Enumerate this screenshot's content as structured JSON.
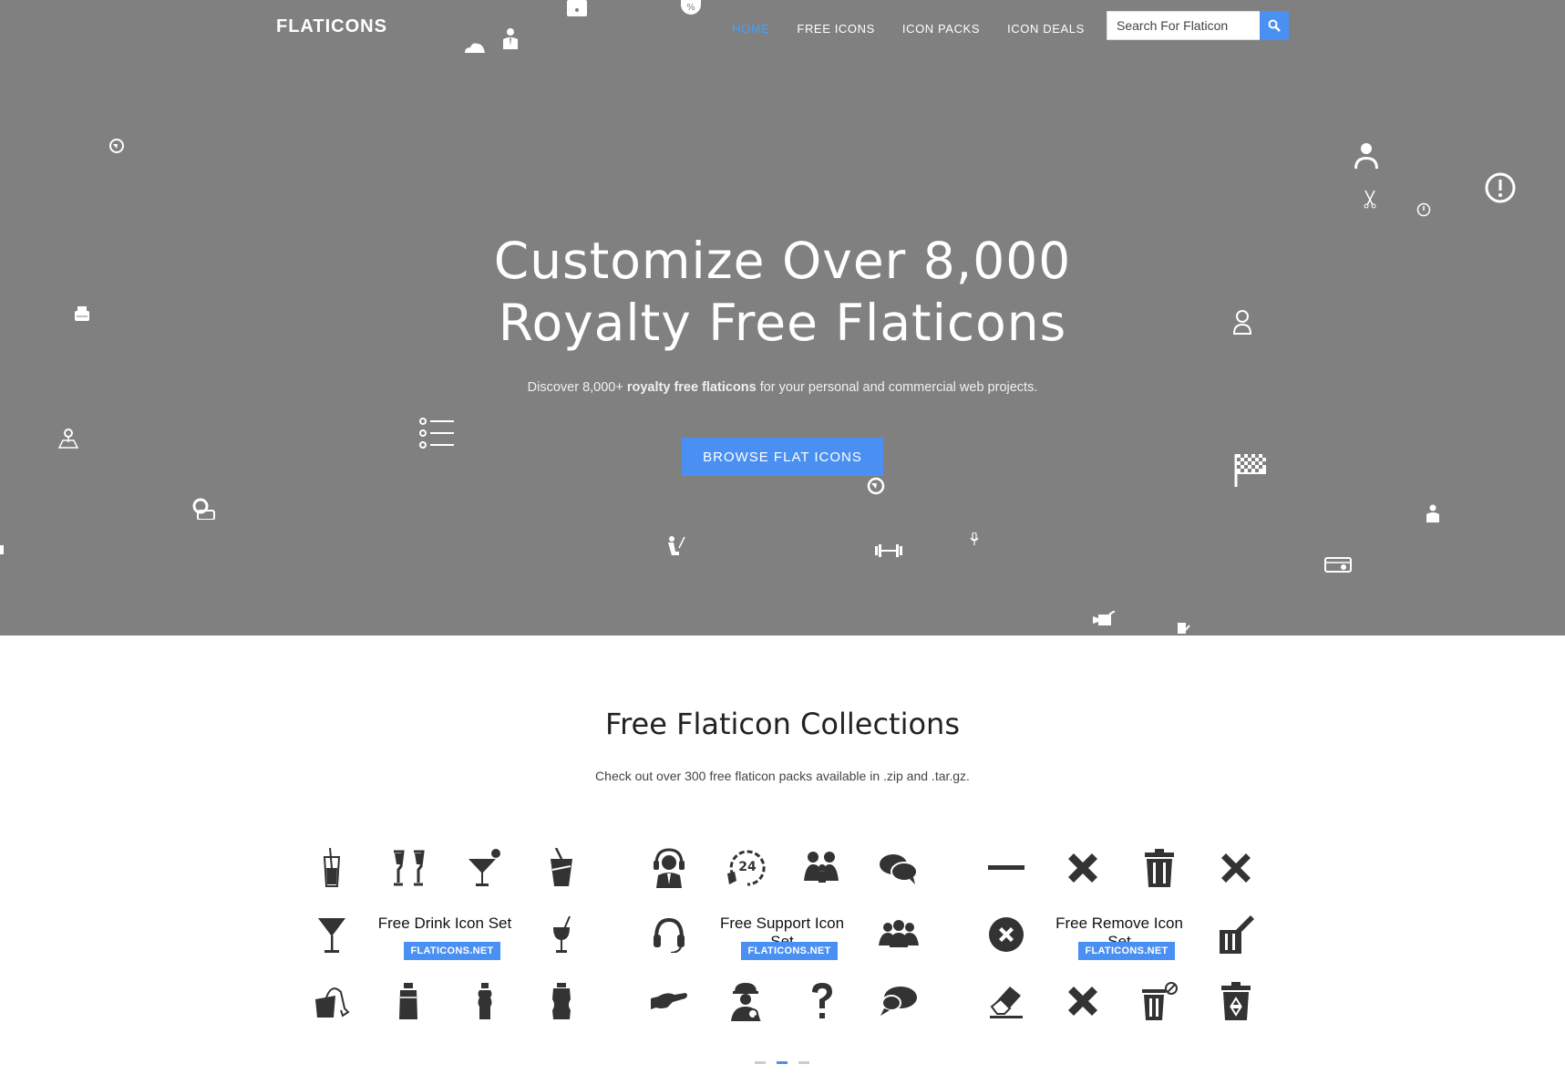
{
  "header": {
    "logo": "FLATICONS",
    "nav": [
      "HOME",
      "FREE ICONS",
      "ICON PACKS",
      "ICON DEALS"
    ],
    "search_placeholder": "Search For Flaticon"
  },
  "hero": {
    "line1": "Customize Over 8,000",
    "line2": "Royalty Free Flaticons",
    "sub_before": "Discover 8,000+ ",
    "sub_bold": "royalty free flaticons",
    "sub_after": " for your personal and commercial web projects.",
    "cta": "BROWSE FLAT ICONS"
  },
  "collections": {
    "title": "Free Flaticon Collections",
    "subtitle": "Check out over 300 free flaticon packs available in .zip and .tar.gz.",
    "packs": [
      {
        "title": "Free Drink Icon Set",
        "badge": "FLATICONS.NET"
      },
      {
        "title": "Free Support Icon Set",
        "badge": "FLATICONS.NET"
      },
      {
        "title": "Free Remove Icon Set",
        "badge": "FLATICONS.NET"
      }
    ],
    "active_slide": 2
  },
  "colors": {
    "accent": "#4a90f2",
    "hero_bg": "#808080",
    "icon_dark": "#333333"
  }
}
